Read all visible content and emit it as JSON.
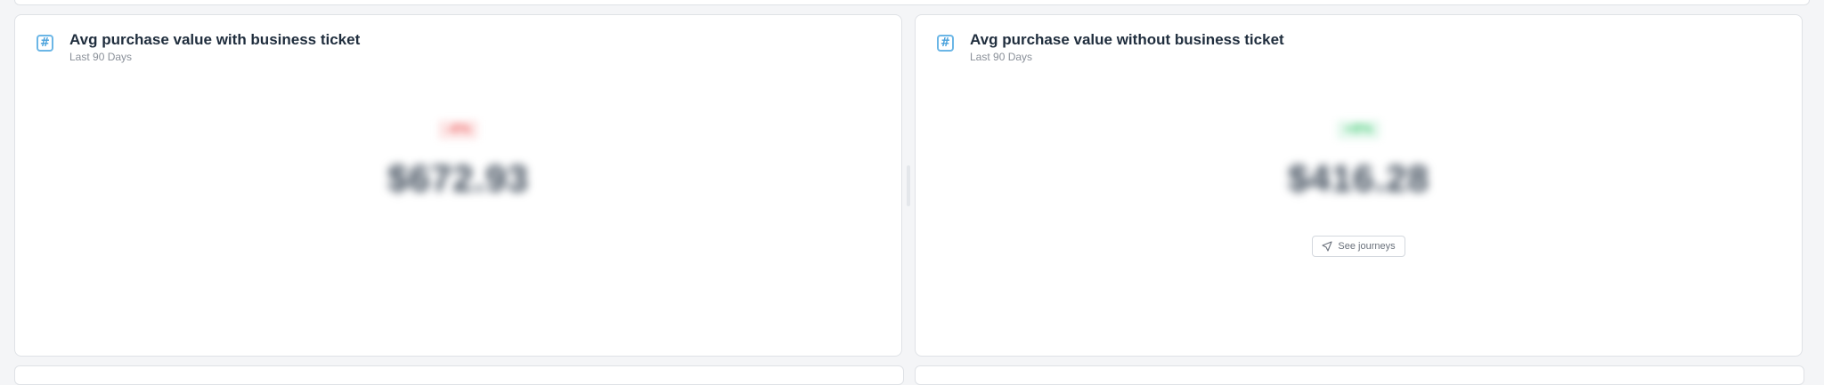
{
  "cards": [
    {
      "title": "Avg purchase value with business ticket",
      "subtitle": "Last 90 Days",
      "delta": "-4%",
      "value": "$672.93"
    },
    {
      "title": "Avg purchase value without business ticket",
      "subtitle": "Last 90 Days",
      "delta": "+8%",
      "value": "$416.28",
      "journeys_label": "See journeys"
    }
  ],
  "colors": {
    "negative": "#f07b7b",
    "positive": "#61d38a",
    "icon_accent": "#4aa2dc"
  }
}
